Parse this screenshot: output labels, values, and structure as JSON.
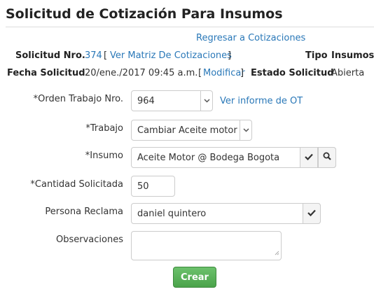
{
  "header": {
    "title": "Solicitud de Cotización Para Insumos"
  },
  "links": {
    "back": "Regresar a Cotizaciones"
  },
  "info": {
    "solicitud_label": "Solicitud Nro.",
    "solicitud_value": "374",
    "ver_matriz_open": "[",
    "ver_matriz": "Ver Matriz De Cotizaciones",
    "ver_matriz_close": "]",
    "tipo_label": "Tipo",
    "tipo_value": "Insumos",
    "fecha_label": "Fecha Solicitud",
    "fecha_value": "20/ene./2017 09:45 a.m.",
    "modificar_open": "[",
    "modificar": "Modificar",
    "modificar_close": "]",
    "estado_label": "Estado Solicitud",
    "estado_value": "Abierta"
  },
  "form": {
    "orden_label": "*Orden Trabajo Nro.",
    "orden_value": "964",
    "ver_informe": "Ver informe de OT",
    "trabajo_label": "*Trabajo",
    "trabajo_value": "Cambiar Aceite motor",
    "insumo_label": "*Insumo",
    "insumo_value": "Aceite Motor @ Bodega Bogota",
    "cantidad_label": "*Cantidad Solicitada",
    "cantidad_value": "50",
    "persona_label": "Persona Reclama",
    "persona_value": "daniel quintero",
    "observaciones_label": "Observaciones",
    "observaciones_value": "",
    "submit_label": "Crear"
  },
  "icons": {
    "check": "check-icon",
    "search": "search-icon",
    "caret": "chevron-down-icon"
  }
}
